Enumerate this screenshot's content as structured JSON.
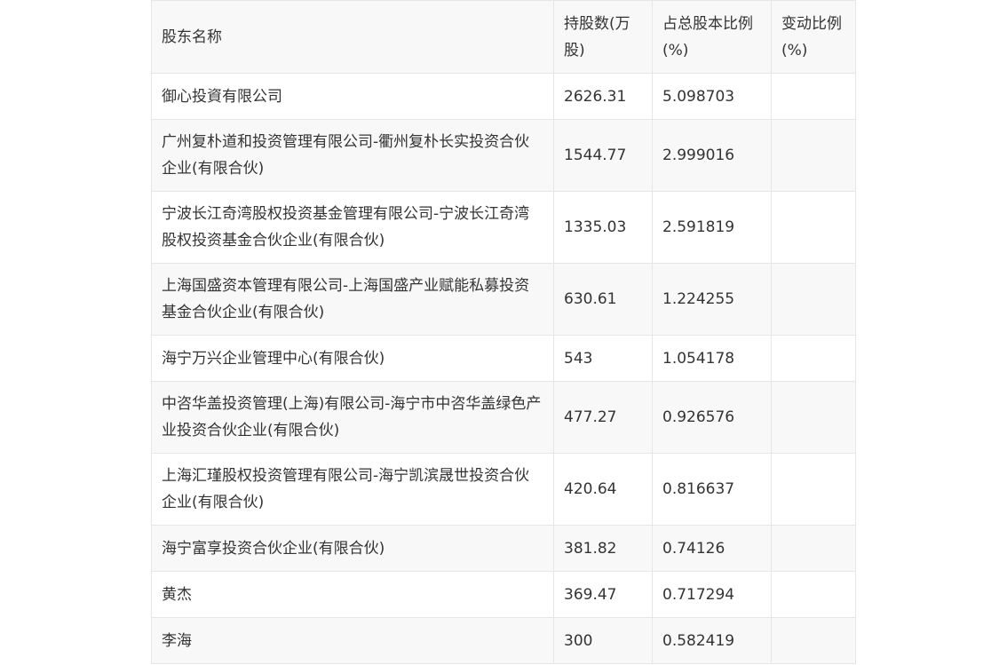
{
  "table": {
    "headers": {
      "name": "股东名称",
      "shares": "持股数(万股)",
      "ratio": "占总股本比例(%)",
      "change": "变动比例(%)"
    },
    "rows": [
      {
        "name": "御心投資有限公司",
        "shares": "2626.31",
        "ratio": "5.098703",
        "change": ""
      },
      {
        "name": "广州复朴道和投资管理有限公司-衢州复朴长实投资合伙企业(有限合伙)",
        "shares": "1544.77",
        "ratio": "2.999016",
        "change": ""
      },
      {
        "name": "宁波长江奇湾股权投资基金管理有限公司-宁波长江奇湾股权投资基金合伙企业(有限合伙)",
        "shares": "1335.03",
        "ratio": "2.591819",
        "change": ""
      },
      {
        "name": "上海国盛资本管理有限公司-上海国盛产业赋能私募投资基金合伙企业(有限合伙)",
        "shares": "630.61",
        "ratio": "1.224255",
        "change": ""
      },
      {
        "name": "海宁万兴企业管理中心(有限合伙)",
        "shares": "543",
        "ratio": "1.054178",
        "change": ""
      },
      {
        "name": "中咨华盖投资管理(上海)有限公司-海宁市中咨华盖绿色产业投资合伙企业(有限合伙)",
        "shares": "477.27",
        "ratio": "0.926576",
        "change": ""
      },
      {
        "name": "上海汇瑾股权投资管理有限公司-海宁凯滨晟世投资合伙企业(有限合伙)",
        "shares": "420.64",
        "ratio": "0.816637",
        "change": ""
      },
      {
        "name": "海宁富享投资合伙企业(有限合伙)",
        "shares": "381.82",
        "ratio": "0.74126",
        "change": ""
      },
      {
        "name": "黄杰",
        "shares": "369.47",
        "ratio": "0.717294",
        "change": ""
      },
      {
        "name": "李海",
        "shares": "300",
        "ratio": "0.582419",
        "change": ""
      }
    ]
  }
}
